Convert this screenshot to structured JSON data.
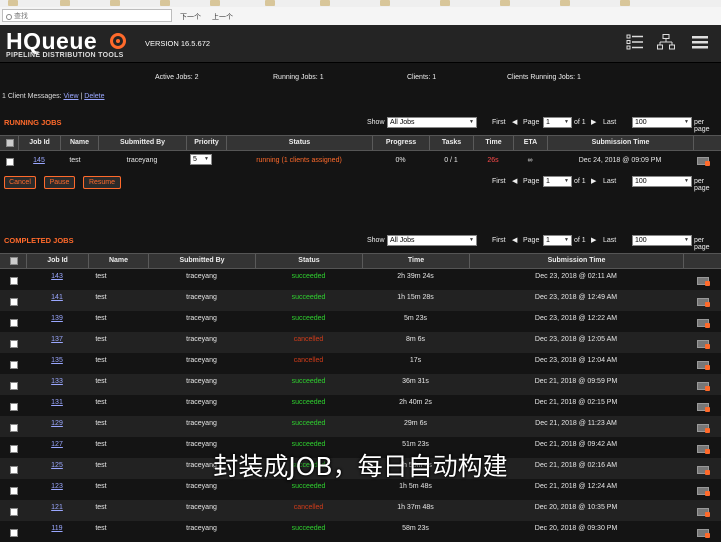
{
  "browser": {
    "find_placeholder": "查找",
    "find_next": "下一个",
    "find_prev": "上一个"
  },
  "header": {
    "logo": "HQueue",
    "tagline": "PIPELINE DISTRIBUTION TOOLS",
    "version": "VERSION 16.5.672"
  },
  "stats": {
    "active_jobs": "Active Jobs: 2",
    "running_jobs": "Running Jobs: 1",
    "clients": "Clients: 1",
    "clients_running": "Clients Running Jobs: 1"
  },
  "messages": {
    "text": "1 Client Messages:",
    "view": "View",
    "sep": "|",
    "delete": "Delete"
  },
  "running": {
    "title": "RUNNING JOBS",
    "show_label": "Show",
    "show_value": "All Jobs",
    "first": "First",
    "page_label": "Page",
    "page_value": "1",
    "of": "of 1",
    "last": "Last",
    "per_page_value": "100",
    "per_page_label": "per page",
    "columns": [
      "Job Id",
      "Name",
      "Submitted By",
      "Priority",
      "Status",
      "Progress",
      "Tasks",
      "Time",
      "ETA",
      "Submission Time"
    ],
    "rows": [
      {
        "id": "145",
        "name": "test",
        "by": "traceyang",
        "priority": "5",
        "status": "running (1 clients assigned)",
        "progress": "0%",
        "tasks": "0 / 1",
        "time": "26s",
        "eta": "∞",
        "submitted": "Dec 24, 2018 @ 09:09 PM"
      }
    ],
    "buttons": {
      "cancel": "Cancel",
      "pause": "Pause",
      "resume": "Resume"
    }
  },
  "completed": {
    "title": "COMPLETED JOBS",
    "show_label": "Show",
    "show_value": "All Jobs",
    "first": "First",
    "page_label": "Page",
    "page_value": "1",
    "of": "of 1",
    "last": "Last",
    "per_page_value": "100",
    "per_page_label": "per page",
    "columns": [
      "Job Id",
      "Name",
      "Submitted By",
      "Status",
      "Time",
      "Submission Time"
    ],
    "rows": [
      {
        "id": "143",
        "name": "test",
        "by": "traceyang",
        "status": "succeeded",
        "ok": true,
        "time": "2h 39m 24s",
        "submitted": "Dec 23, 2018 @ 02:11 AM"
      },
      {
        "id": "141",
        "name": "test",
        "by": "traceyang",
        "status": "succeeded",
        "ok": true,
        "time": "1h 15m 28s",
        "submitted": "Dec 23, 2018 @ 12:49 AM"
      },
      {
        "id": "139",
        "name": "test",
        "by": "traceyang",
        "status": "succeeded",
        "ok": true,
        "time": "5m 23s",
        "submitted": "Dec 23, 2018 @ 12:22 AM"
      },
      {
        "id": "137",
        "name": "test",
        "by": "traceyang",
        "status": "cancelled",
        "ok": false,
        "time": "8m 6s",
        "submitted": "Dec 23, 2018 @ 12:05 AM"
      },
      {
        "id": "135",
        "name": "test",
        "by": "traceyang",
        "status": "cancelled",
        "ok": false,
        "time": "17s",
        "submitted": "Dec 23, 2018 @ 12:04 AM"
      },
      {
        "id": "133",
        "name": "test",
        "by": "traceyang",
        "status": "succeeded",
        "ok": true,
        "time": "36m 31s",
        "submitted": "Dec 21, 2018 @ 09:59 PM"
      },
      {
        "id": "131",
        "name": "test",
        "by": "traceyang",
        "status": "succeeded",
        "ok": true,
        "time": "2h 40m 2s",
        "submitted": "Dec 21, 2018 @ 02:15 PM"
      },
      {
        "id": "129",
        "name": "test",
        "by": "traceyang",
        "status": "succeeded",
        "ok": true,
        "time": "29m 6s",
        "submitted": "Dec 21, 2018 @ 11:23 AM"
      },
      {
        "id": "127",
        "name": "test",
        "by": "traceyang",
        "status": "succeeded",
        "ok": true,
        "time": "51m 23s",
        "submitted": "Dec 21, 2018 @ 09:42 AM"
      },
      {
        "id": "125",
        "name": "test",
        "by": "traceyang",
        "status": "succeeded",
        "ok": true,
        "time": "4h 55m 4s",
        "submitted": "Dec 21, 2018 @ 02:16 AM"
      },
      {
        "id": "123",
        "name": "test",
        "by": "traceyang",
        "status": "succeeded",
        "ok": true,
        "time": "1h 5m 48s",
        "submitted": "Dec 21, 2018 @ 12:24 AM"
      },
      {
        "id": "121",
        "name": "test",
        "by": "traceyang",
        "status": "cancelled",
        "ok": false,
        "time": "1h 37m 48s",
        "submitted": "Dec 20, 2018 @ 10:35 PM"
      },
      {
        "id": "119",
        "name": "test",
        "by": "traceyang",
        "status": "succeeded",
        "ok": true,
        "time": "58m 23s",
        "submitted": "Dec 20, 2018 @ 09:30 PM"
      }
    ]
  },
  "caption": "封装成JOB，每日自动构建",
  "colors": {
    "accent": "#ff6a2b",
    "success": "#2fd12f",
    "failure": "#d23c1a",
    "link": "#9aa7ff"
  }
}
